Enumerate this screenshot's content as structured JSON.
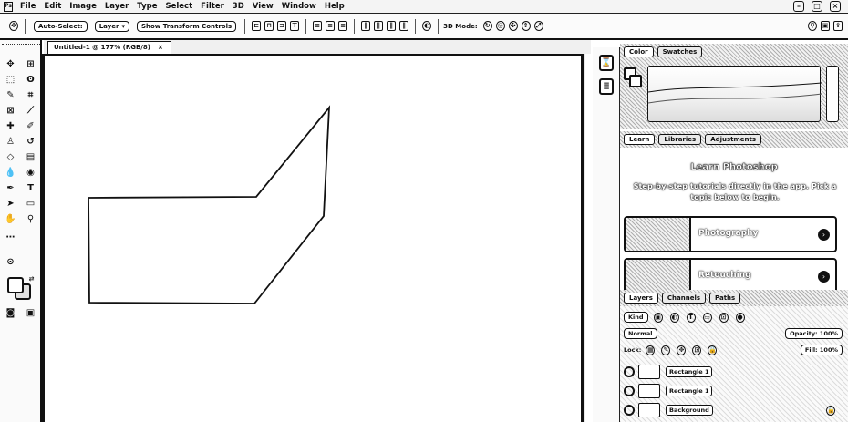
{
  "menubar": {
    "logo": "Ps",
    "items": [
      "File",
      "Edit",
      "Image",
      "Layer",
      "Type",
      "Select",
      "Filter",
      "3D",
      "View",
      "Window",
      "Help"
    ],
    "window_controls": [
      "–",
      "□",
      "×"
    ]
  },
  "options_bar": {
    "auto_select_label": "Auto-Select:",
    "auto_select_value": "Layer",
    "show_transform_label": "Show Transform Controls",
    "mode_3d_label": "3D Mode:"
  },
  "document": {
    "tab_title": "Untitled-1 @ 177% (RGB/8)",
    "tab_close": "×"
  },
  "panels": {
    "color_tabs": [
      "Color",
      "Swatches"
    ],
    "learn_tabs": [
      "Learn",
      "Libraries",
      "Adjustments"
    ],
    "learn_title": "Learn Photoshop",
    "learn_desc": "Step-by-step tutorials directly in the app. Pick a topic below to begin.",
    "learn_cards": [
      {
        "label": "Photography"
      },
      {
        "label": "Retouching"
      }
    ],
    "layers_tabs": [
      "Layers",
      "Channels",
      "Paths"
    ],
    "layers_filter": "Kind",
    "layers_mode": "Normal",
    "layers_opacity": "Opacity: 100%",
    "layers_fill": "Fill: 100%",
    "layers_lock": "Lock:",
    "layers": [
      {
        "name": "Rectangle 1"
      },
      {
        "name": "Rectangle 1"
      },
      {
        "name": "Background"
      }
    ]
  },
  "colors": {
    "ink": "#111111",
    "panel_bg": "#fafafa"
  }
}
